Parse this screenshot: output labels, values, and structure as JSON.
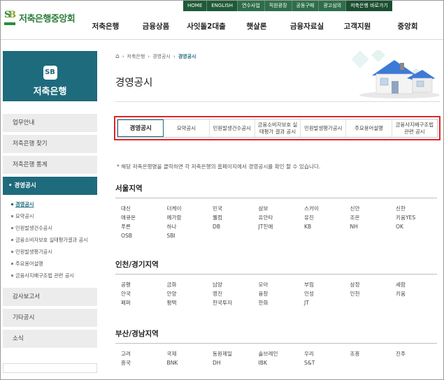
{
  "header": {
    "logo_mark": "SB",
    "logo_name": "저축은행중앙회",
    "topbar": [
      "HOME",
      "ENGLISH",
      "연수사업",
      "직원광장",
      "공동구매",
      "광고심의",
      "저축은행 바로가기"
    ],
    "mainnav": [
      "저축은행",
      "금융상품",
      "사잇돌2대출",
      "햇살론",
      "금융자료실",
      "고객지원",
      "중앙회"
    ]
  },
  "sidebar": {
    "badge": "SB",
    "title": "저축은행",
    "items_top": [
      "업무안내",
      "저축은행 찾기",
      "저축은행 통계"
    ],
    "active_item": "경영공시",
    "sub_items": [
      "경영공시",
      "요약공시",
      "민원발생건수공시",
      "금융소비자보호 실태평가결과 공시",
      "민원발생평가공시",
      "주요용어설명",
      "금융사지배구조법 관련 공시"
    ],
    "items_bottom": [
      "감사보고서",
      "기타공시",
      "소식"
    ]
  },
  "breadcrumb": {
    "home_icon": "⌂",
    "items": [
      "저축은행",
      "경영공시"
    ],
    "current": "경영공시"
  },
  "page_title": "경영공시",
  "tabs": [
    {
      "label": "경영공시",
      "active": true
    },
    {
      "label": "요약공시",
      "active": false
    },
    {
      "label": "민원발생건수공시",
      "active": false
    },
    {
      "label": "금융소비자보호 실태평가 결과 공시",
      "active": false
    },
    {
      "label": "민원발생평가공시",
      "active": false
    },
    {
      "label": "주요용어설명",
      "active": false
    },
    {
      "label": "금융사지배구조법 관련 공시",
      "active": false
    }
  ],
  "notice": "* 해당 저축은행명을 클릭하면 각 저축은행의 홈페이지에서 경영공시를 확인 할 수 있습니다.",
  "regions": [
    {
      "title": "서울지역",
      "banks": [
        "대신",
        "더케이",
        "민국",
        "삼보",
        "스카이",
        "신안",
        "신한",
        "애큐온",
        "예가람",
        "웰컴",
        "유안타",
        "유진",
        "조은",
        "키움YES",
        "푸른",
        "하나",
        "DB",
        "JT친애",
        "KB",
        "NH",
        "OK",
        "OSB",
        "SBI"
      ]
    },
    {
      "title": "인천/경기지역",
      "banks": [
        "공평",
        "금화",
        "남양",
        "모아",
        "부림",
        "삼정",
        "세람",
        "안국",
        "안양",
        "영진",
        "융창",
        "인성",
        "인천",
        "키움",
        "페퍼",
        "평택",
        "한국투자",
        "한화",
        "JT"
      ]
    },
    {
      "title": "부산/경남지역",
      "banks": [
        "고려",
        "국제",
        "동원제일",
        "솔브레인",
        "우리",
        "조흥",
        "진주",
        "흥국",
        "BNK",
        "DH",
        "IBK",
        "S&T"
      ]
    }
  ]
}
